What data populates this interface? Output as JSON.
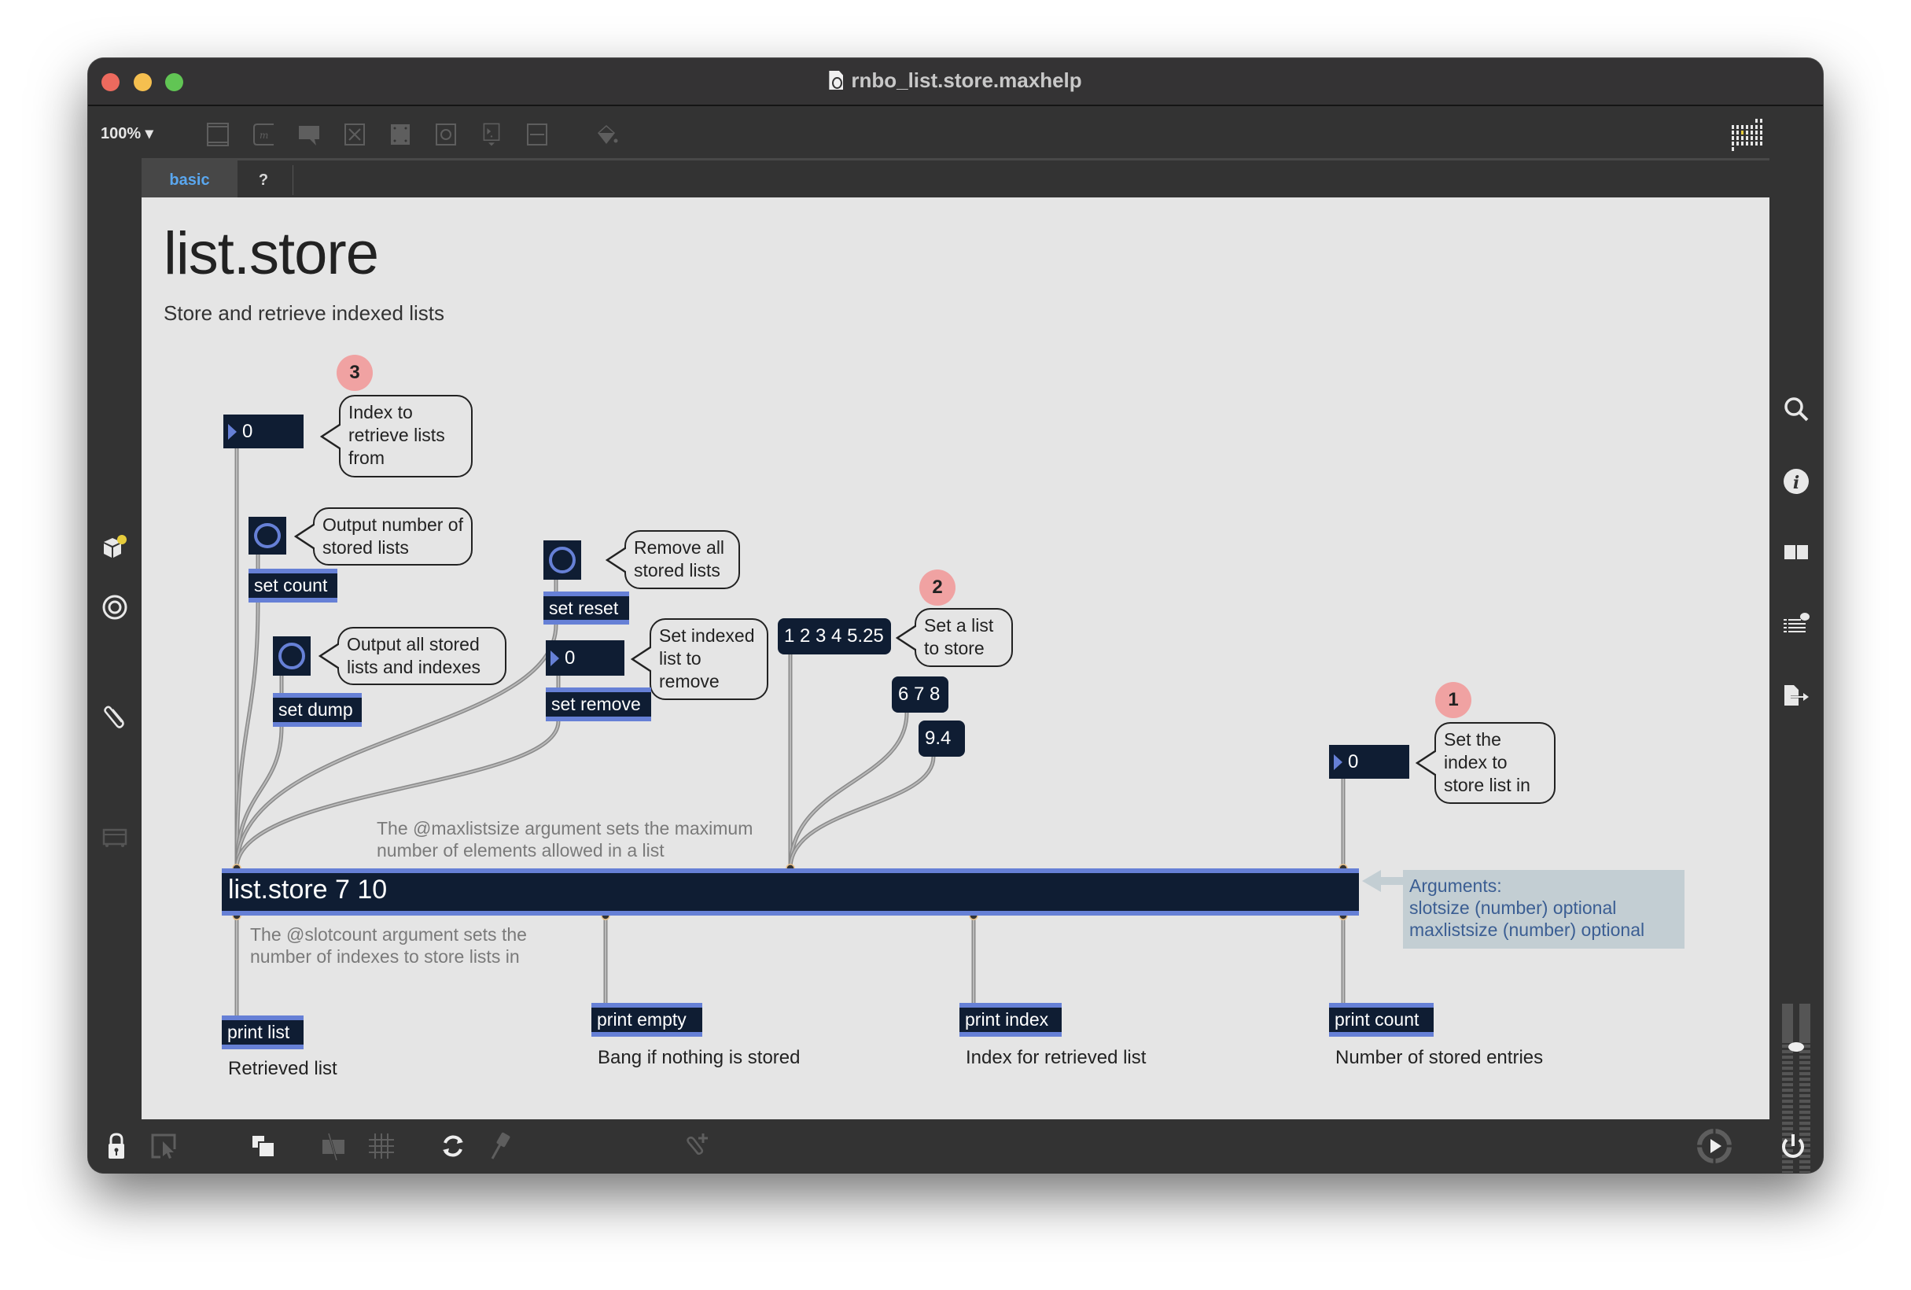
{
  "window": {
    "title": "rnbo_list.store.maxhelp"
  },
  "toolbar": {
    "zoom_label": "100% ▾",
    "icons": [
      "new-object-icon",
      "new-message-icon",
      "new-comment-icon",
      "new-toggle-icon",
      "new-panel-icon",
      "new-bang-icon",
      "new-number-icon",
      "new-slider-icon",
      "paint-bucket-icon"
    ]
  },
  "tabs": [
    {
      "label": "basic",
      "active": true
    },
    {
      "label": "?",
      "active": false
    }
  ],
  "patch": {
    "title": "list.store",
    "subtitle": "Store and retrieve indexed lists",
    "badges": {
      "one": "1",
      "two": "2",
      "three": "3"
    },
    "number_retrieve": "0",
    "bubble_retrieve": "Index to retrieve lists from",
    "bubble_count": "Output number of stored lists",
    "msg_set_count": "set count",
    "bubble_dump": "Output all stored lists and indexes",
    "msg_set_dump": "set dump",
    "bubble_reset": "Remove all stored lists",
    "msg_set_reset": "set reset",
    "number_remove": "0",
    "bubble_remove": "Set indexed list to remove",
    "msg_set_remove": "set remove",
    "msg_list": "1 2 3 4 5.25",
    "bubble_list": "Set a list to store",
    "msg_678": "6 7 8",
    "msg_94": "9.4",
    "number_store": "0",
    "bubble_store": "Set the index to store list in",
    "comment_maxlistsize": "The @maxlistsize argument sets the maximum number of elements allowed in a list",
    "main_object": "list.store 7 10",
    "arguments": {
      "heading": "Arguments:",
      "lines": [
        "slotsize (number) optional",
        "maxlistsize (number) optional"
      ]
    },
    "comment_slotcount": "The @slotcount argument sets the number of indexes to store lists in",
    "outputs": [
      {
        "object": "print list",
        "caption": "Retrieved list"
      },
      {
        "object": "print empty",
        "caption": "Bang if nothing is stored"
      },
      {
        "object": "print index",
        "caption": "Index for retrieved list"
      },
      {
        "object": "print count",
        "caption": "Number of stored entries"
      }
    ]
  },
  "colors": {
    "object_bg": "#0f1d33",
    "inlet_bar": "#6680d6",
    "badge": "#f0a2a2",
    "active_tab": "#5aa7ef",
    "args_bg": "#c3ced3",
    "args_text": "#3b5e93"
  }
}
